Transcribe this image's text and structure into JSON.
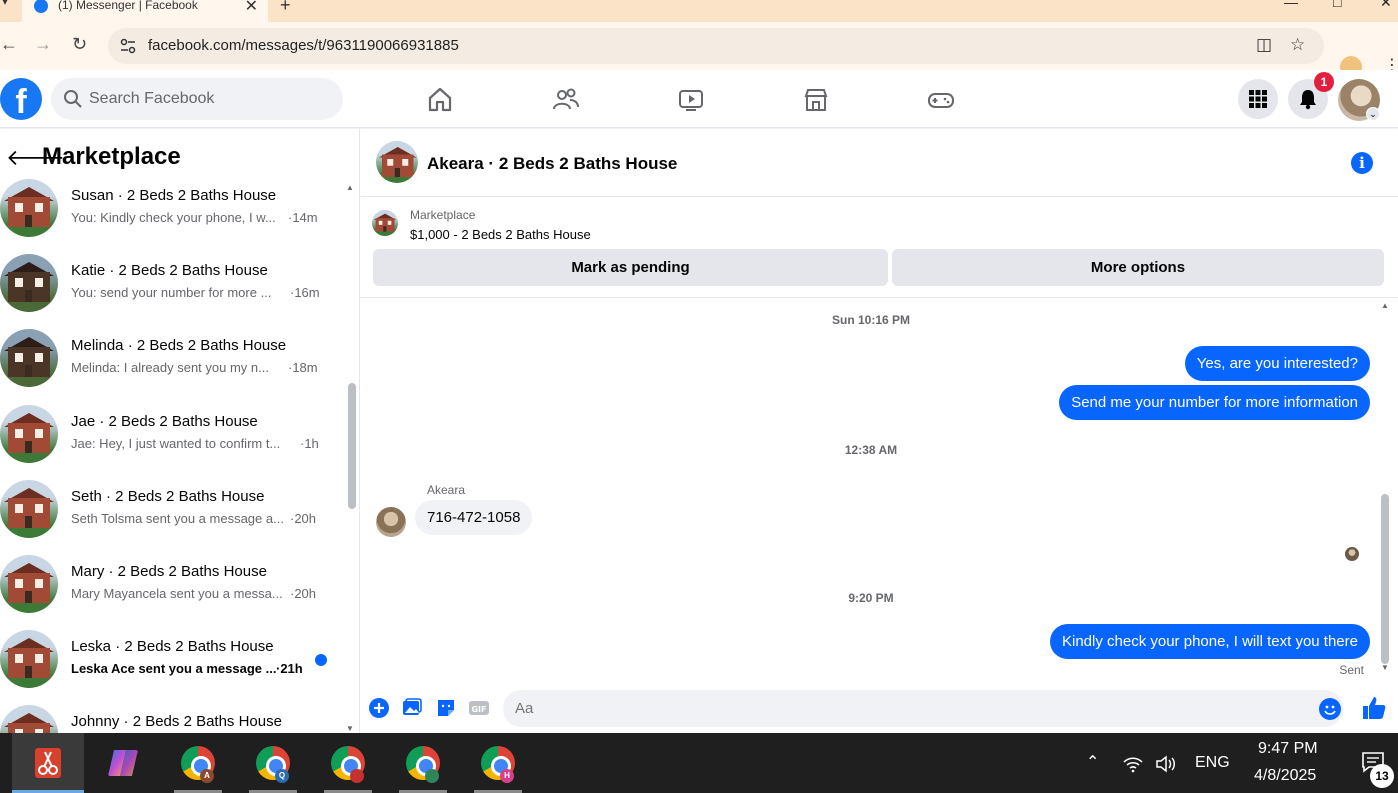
{
  "browser": {
    "tab_title": "(1) Messenger | Facebook",
    "url": "facebook.com/messages/t/9631190066931885"
  },
  "fb": {
    "search_placeholder": "Search Facebook",
    "notification_count": "1"
  },
  "sidebar": {
    "title": "Marketplace",
    "conversations": [
      {
        "name": "Susan · 2 Beds 2 Baths House",
        "snippet": "You: Kindly check your phone, I w...",
        "time": "·14m",
        "unread": false,
        "thumb": "light"
      },
      {
        "name": "Katie · 2 Beds 2 Baths House",
        "snippet": "You: send your number for more ...",
        "time": "·16m",
        "unread": false,
        "thumb": "dark"
      },
      {
        "name": "Melinda · 2 Beds 2 Baths House",
        "snippet": "Melinda: I already sent you my n...",
        "time": "·18m",
        "unread": false,
        "thumb": "dark"
      },
      {
        "name": "Jae · 2 Beds 2 Baths House",
        "snippet": "Jae: Hey, I just wanted to confirm t...",
        "time": "·1h",
        "unread": false,
        "thumb": "light"
      },
      {
        "name": "Seth · 2 Beds 2 Baths House",
        "snippet": "Seth Tolsma sent you a message a...",
        "time": "·20h",
        "unread": false,
        "thumb": "light"
      },
      {
        "name": "Mary · 2 Beds 2 Baths House",
        "snippet": "Mary Mayancela sent you a messa...",
        "time": "·20h",
        "unread": false,
        "thumb": "light"
      },
      {
        "name": "Leska · 2 Beds 2 Baths House",
        "snippet": "Leska Ace sent you a message ...",
        "time": "·21h",
        "unread": true,
        "thumb": "light"
      },
      {
        "name": "Johnny · 2 Beds 2 Baths House",
        "snippet": "",
        "time": "",
        "unread": false,
        "thumb": "light"
      }
    ]
  },
  "chat": {
    "title": "Akeara · 2 Beds 2 Baths House",
    "listing_category": "Marketplace",
    "listing_price": "$1,000 - 2 Beds 2 Baths House",
    "mark_pending_label": "Mark as pending",
    "more_options_label": "More options",
    "timestamps": [
      "Sun 10:16 PM",
      "12:38 AM",
      "9:20 PM"
    ],
    "outgoing_1": "Yes, are you interested?",
    "outgoing_2": "Send me your number for more information",
    "incoming_sender": "Akeara",
    "incoming_1": "716-472-1058",
    "outgoing_3": "Kindly check your phone, I will text you there",
    "sent_status": "Sent",
    "composer_placeholder": "Aa"
  },
  "taskbar": {
    "language": "ENG",
    "time": "9:47 PM",
    "date": "4/8/2025",
    "notification_count": "13",
    "chrome_profiles": [
      {
        "letter": "A",
        "color": "#8b4a2b"
      },
      {
        "letter": "Q",
        "color": "#2b6cb0"
      },
      {
        "letter": "",
        "color": "#c53030"
      },
      {
        "letter": "",
        "color": "#2f855a"
      },
      {
        "letter": "H",
        "color": "#d53f8c"
      }
    ]
  },
  "colors": {
    "fb_blue": "#1877f2",
    "messenger_blue": "#0866ff",
    "badge_red": "#e41e3f"
  }
}
